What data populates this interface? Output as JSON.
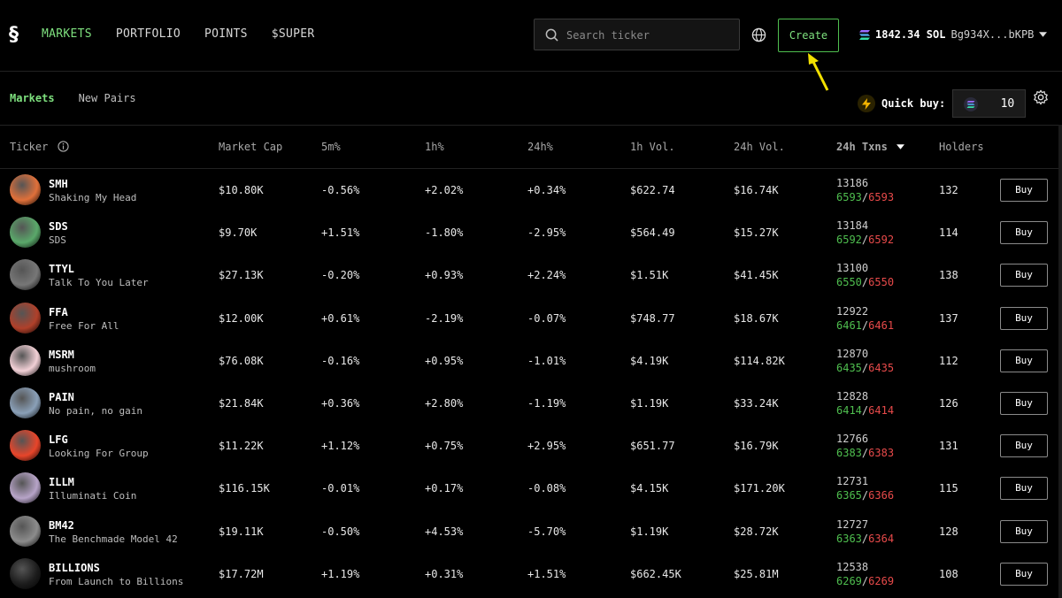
{
  "nav": {
    "logo": "§",
    "items": [
      "MARKETS",
      "PORTFOLIO",
      "POINTS",
      "$SUPER"
    ]
  },
  "search": {
    "placeholder": "Search ticker"
  },
  "create_label": "Create",
  "wallet": {
    "balance": "1842.34 SOL",
    "address": "Bg934X...bKPB"
  },
  "subtabs": [
    "Markets",
    "New Pairs"
  ],
  "quick_buy": {
    "label": "Quick buy:",
    "value": "10"
  },
  "headers": [
    "Ticker",
    "Market Cap",
    "5m%",
    "1h%",
    "24h%",
    "1h Vol.",
    "24h Vol.",
    "24h Txns",
    "Holders"
  ],
  "buy_label": "Buy",
  "colors": {
    "accent": "#7ee07e",
    "positive": "#4fbf4f",
    "negative": "#e84a4a"
  },
  "rows": [
    {
      "ticker": "SMH",
      "name": "Shaking My Head",
      "mcap": "$10.80K",
      "m5": "-0.56%",
      "h1": "+2.02%",
      "h24": "+0.34%",
      "vol1h": "$622.74",
      "vol24h": "$16.74K",
      "txns": "13186",
      "buys": "6593",
      "sells": "6593",
      "holders": "132",
      "avatar": "#e0703a"
    },
    {
      "ticker": "SDS",
      "name": "SDS",
      "mcap": "$9.70K",
      "m5": "+1.51%",
      "h1": "-1.80%",
      "h24": "-2.95%",
      "vol1h": "$564.49",
      "vol24h": "$15.27K",
      "txns": "13184",
      "buys": "6592",
      "sells": "6592",
      "holders": "114",
      "avatar": "#5aa86a"
    },
    {
      "ticker": "TTYL",
      "name": "Talk To You Later",
      "mcap": "$27.13K",
      "m5": "-0.20%",
      "h1": "+0.93%",
      "h24": "+2.24%",
      "vol1h": "$1.51K",
      "vol24h": "$41.45K",
      "txns": "13100",
      "buys": "6550",
      "sells": "6550",
      "holders": "138",
      "avatar": "#777777"
    },
    {
      "ticker": "FFA",
      "name": "Free For All",
      "mcap": "$12.00K",
      "m5": "+0.61%",
      "h1": "-2.19%",
      "h24": "-0.07%",
      "vol1h": "$748.77",
      "vol24h": "$18.67K",
      "txns": "12922",
      "buys": "6461",
      "sells": "6461",
      "holders": "137",
      "avatar": "#b0402a"
    },
    {
      "ticker": "MSRM",
      "name": "mushroom",
      "mcap": "$76.08K",
      "m5": "-0.16%",
      "h1": "+0.95%",
      "h24": "-1.01%",
      "vol1h": "$4.19K",
      "vol24h": "$114.82K",
      "txns": "12870",
      "buys": "6435",
      "sells": "6435",
      "holders": "112",
      "avatar": "#f2d0d6"
    },
    {
      "ticker": "PAIN",
      "name": "No pain, no gain",
      "mcap": "$21.84K",
      "m5": "+0.36%",
      "h1": "+2.80%",
      "h24": "-1.19%",
      "vol1h": "$1.19K",
      "vol24h": "$33.24K",
      "txns": "12828",
      "buys": "6414",
      "sells": "6414",
      "holders": "126",
      "avatar": "#8aa0b8"
    },
    {
      "ticker": "LFG",
      "name": "Looking For Group",
      "mcap": "$11.22K",
      "m5": "+1.12%",
      "h1": "+0.75%",
      "h24": "+2.95%",
      "vol1h": "$651.77",
      "vol24h": "$16.79K",
      "txns": "12766",
      "buys": "6383",
      "sells": "6383",
      "holders": "131",
      "avatar": "#e8452a"
    },
    {
      "ticker": "ILLM",
      "name": "Illuminati Coin",
      "mcap": "$116.15K",
      "m5": "-0.01%",
      "h1": "+0.17%",
      "h24": "-0.08%",
      "vol1h": "$4.15K",
      "vol24h": "$171.20K",
      "txns": "12731",
      "buys": "6365",
      "sells": "6366",
      "holders": "115",
      "avatar": "#b7a4c8"
    },
    {
      "ticker": "BM42",
      "name": "The Benchmade Model 42",
      "mcap": "$19.11K",
      "m5": "-0.50%",
      "h1": "+4.53%",
      "h24": "-5.70%",
      "vol1h": "$1.19K",
      "vol24h": "$28.72K",
      "txns": "12727",
      "buys": "6363",
      "sells": "6364",
      "holders": "128",
      "avatar": "#8c8c8c"
    },
    {
      "ticker": "BILLIONS",
      "name": "From Launch to Billions",
      "mcap": "$17.72M",
      "m5": "+1.19%",
      "h1": "+0.31%",
      "h24": "+1.51%",
      "vol1h": "$662.45K",
      "vol24h": "$25.81M",
      "txns": "12538",
      "buys": "6269",
      "sells": "6269",
      "holders": "108",
      "avatar": "#1c1c1c"
    }
  ]
}
